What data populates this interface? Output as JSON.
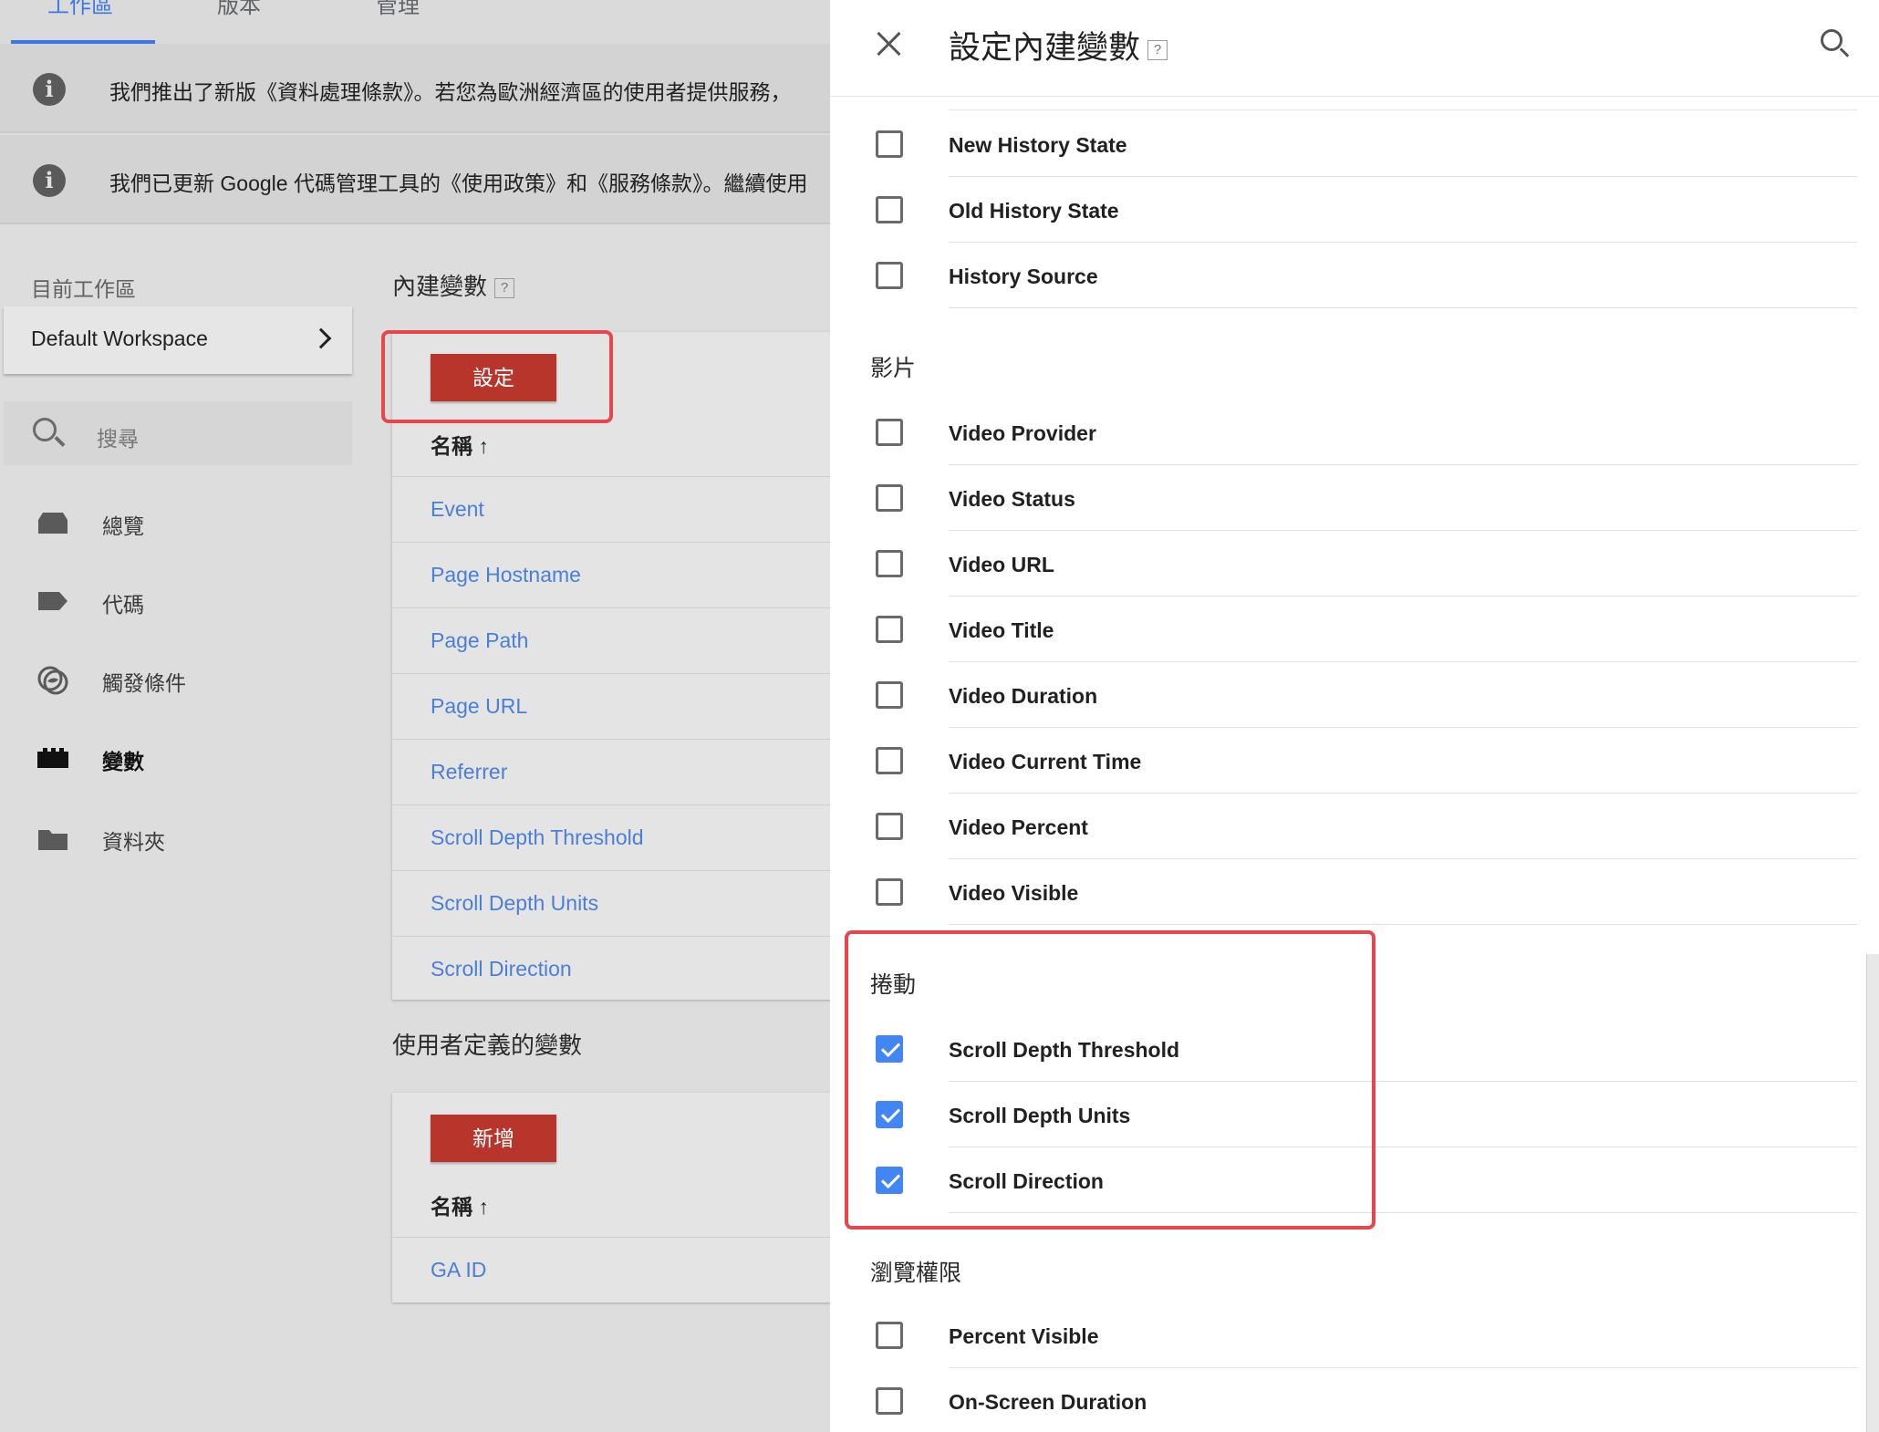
{
  "topnav": {
    "tabs": [
      "工作區",
      "版本",
      "管理"
    ]
  },
  "notices": [
    "我們推出了新版《資料處理條款》。若您為歐洲經濟區的使用者提供服務，",
    "我們已更新 Google 代碼管理工具的《使用政策》和《服務條款》。繼續使用"
  ],
  "sidebar": {
    "workspace_label": "目前工作區",
    "workspace_name": "Default Workspace",
    "search_placeholder": "搜尋",
    "items": [
      {
        "label": "總覽",
        "icon": "overview-icon"
      },
      {
        "label": "代碼",
        "icon": "tag-icon"
      },
      {
        "label": "觸發條件",
        "icon": "trigger-icon"
      },
      {
        "label": "變數",
        "icon": "variable-icon",
        "active": true
      },
      {
        "label": "資料夾",
        "icon": "folder-icon"
      }
    ]
  },
  "builtin": {
    "title": "內建變數",
    "help": "?",
    "configure_button": "設定",
    "name_header": "名稱 ↑",
    "rows": [
      "Event",
      "Page Hostname",
      "Page Path",
      "Page URL",
      "Referrer",
      "Scroll Depth Threshold",
      "Scroll Depth Units",
      "Scroll Direction"
    ]
  },
  "user_defined": {
    "title": "使用者定義的變數",
    "new_button": "新增",
    "name_header": "名稱 ↑",
    "rows": [
      "GA ID"
    ]
  },
  "panel": {
    "title": "設定內建變數",
    "help": "?",
    "history_items": [
      {
        "label": "New History State",
        "checked": false
      },
      {
        "label": "Old History State",
        "checked": false
      },
      {
        "label": "History Source",
        "checked": false
      }
    ],
    "video_title": "影片",
    "video_items": [
      {
        "label": "Video Provider",
        "checked": false
      },
      {
        "label": "Video Status",
        "checked": false
      },
      {
        "label": "Video URL",
        "checked": false
      },
      {
        "label": "Video Title",
        "checked": false
      },
      {
        "label": "Video Duration",
        "checked": false
      },
      {
        "label": "Video Current Time",
        "checked": false
      },
      {
        "label": "Video Percent",
        "checked": false
      },
      {
        "label": "Video Visible",
        "checked": false
      }
    ],
    "scroll_title": "捲動",
    "scroll_items": [
      {
        "label": "Scroll Depth Threshold",
        "checked": true
      },
      {
        "label": "Scroll Depth Units",
        "checked": true
      },
      {
        "label": "Scroll Direction",
        "checked": true
      }
    ],
    "visibility_title": "瀏覽權限",
    "visibility_items": [
      {
        "label": "Percent Visible",
        "checked": false
      },
      {
        "label": "On-Screen Duration",
        "checked": false
      }
    ]
  },
  "colors": {
    "accent_red": "#b8352c",
    "link_blue": "#4a7fd6",
    "checkbox_blue": "#4285f4",
    "highlight_red": "#e8454c"
  }
}
